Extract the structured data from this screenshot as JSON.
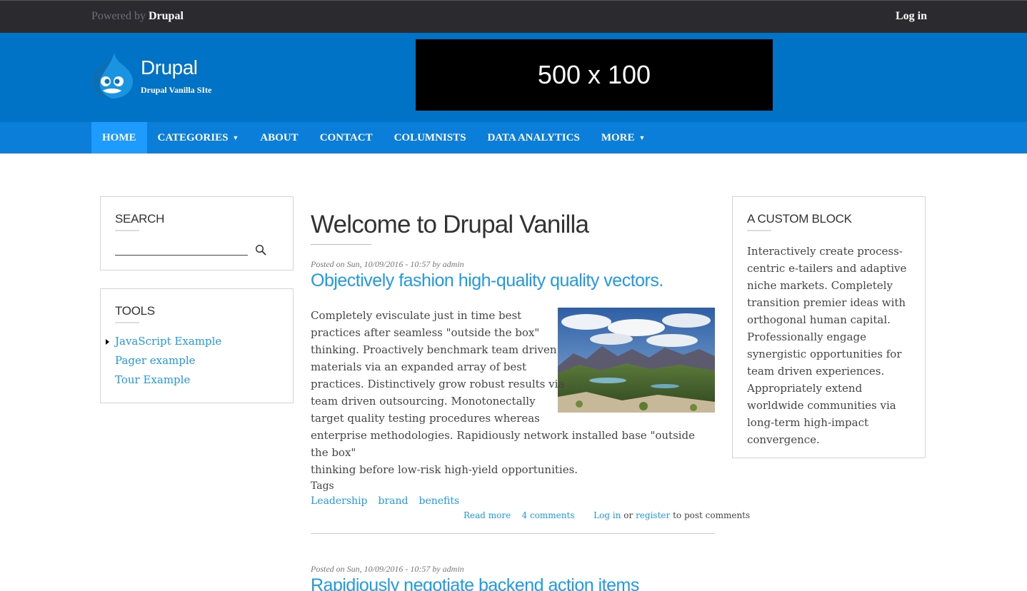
{
  "topbar": {
    "powered_prefix": "Powered by",
    "powered_brand": "Drupal",
    "login": "Log in"
  },
  "header": {
    "site_name": "Drupal",
    "slogan": "Drupal Vanilla SIte",
    "ad_text": "500 x 100",
    "colors": {
      "header_bg": "#0073c6",
      "nav_bg": "#0a7ed9",
      "active_tab": "#1e9bff",
      "link": "#1e9be6"
    }
  },
  "nav": {
    "items": [
      {
        "label": "Home"
      },
      {
        "label": "Categories"
      },
      {
        "label": "About"
      },
      {
        "label": "Contact"
      },
      {
        "label": "Columnists"
      },
      {
        "label": "Data Analytics"
      },
      {
        "label": "More"
      }
    ],
    "caret": "▼"
  },
  "search": {
    "title": "SEARCH",
    "value": "",
    "icon": "search-icon"
  },
  "tools": {
    "title": "TOOLS",
    "items": [
      {
        "label": "JavaScript Example"
      },
      {
        "label": "Pager example"
      },
      {
        "label": "Tour Example"
      }
    ]
  },
  "custom_block": {
    "title": "A CUSTOM BLOCK",
    "body": "Interactively create process-centric e-tailers and adaptive niche markets. Completely transition premier ideas with orthogonal human capital. Professionally engage synergistic opportunities for team driven experiences. Appropriately extend worldwide communities via long-term high-impact convergence."
  },
  "main": {
    "page_title": "Welcome to Drupal Vanilla",
    "post1": {
      "meta": "Posted on Sun, 10/09/2016 - 10:57 by admin",
      "title": "Objectively fashion high-quality quality vectors.",
      "body_lines": [
        "Completely evisculate just in time best",
        "practices after seamless \"outside the box\"",
        "thinking. Proactively benchmark team driven",
        "materials via an expanded array of best",
        "practices. Distinctively grow robust results via",
        "team driven outsourcing. Monotonectally",
        "target quality testing procedures whereas",
        "enterprise methodologies. Rapidiously network installed base \"outside the box\"",
        "thinking before low-risk high-yield opportunities."
      ],
      "tags_label": "Tags",
      "tags": [
        "Leadership",
        "brand",
        "benefits"
      ],
      "read_more": "Read more",
      "comments": "4 comments",
      "login_link": "Log in",
      "or_text": "or",
      "register_link": "register",
      "post_comments_text": "to post comments"
    },
    "post2": {
      "meta": "Posted on Sun, 10/09/2016 - 10:57 by admin",
      "title": "Rapidiously negotiate backend action items"
    }
  }
}
